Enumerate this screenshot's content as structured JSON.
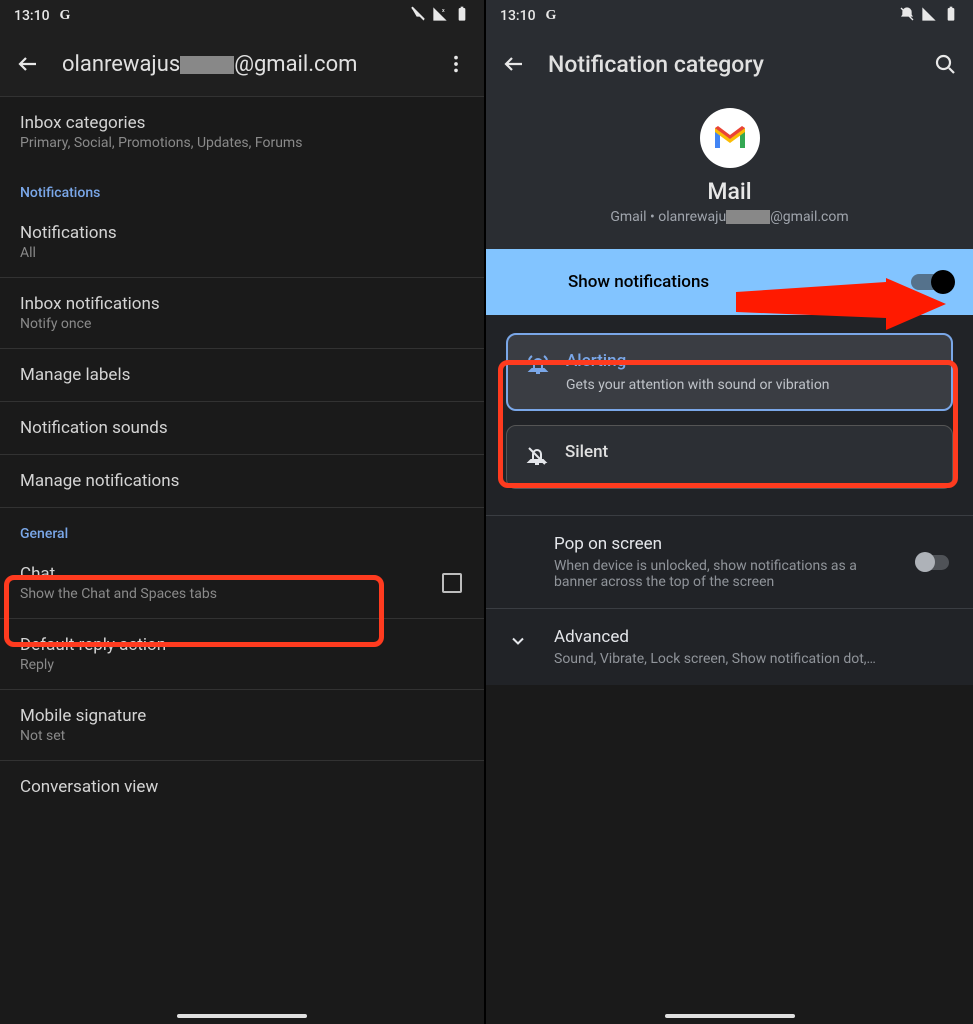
{
  "status": {
    "time": "13:10",
    "g": "G"
  },
  "left": {
    "title_prefix": "olanrewajus",
    "title_suffix": "@gmail.com",
    "rows": {
      "inbox_cat": {
        "title": "Inbox categories",
        "sub": "Primary, Social, Promotions, Updates, Forums"
      },
      "notif_header": "Notifications",
      "notifications": {
        "title": "Notifications",
        "sub": "All"
      },
      "inbox_notif": {
        "title": "Inbox notifications",
        "sub": "Notify once"
      },
      "manage_labels": {
        "title": "Manage labels"
      },
      "notif_sounds": {
        "title": "Notification sounds"
      },
      "manage_notif": {
        "title": "Manage notifications"
      },
      "general_header": "General",
      "chat": {
        "title": "Chat",
        "sub": "Show the Chat and Spaces tabs"
      },
      "reply": {
        "title": "Default reply action",
        "sub": "Reply"
      },
      "signature": {
        "title": "Mobile signature",
        "sub": "Not set"
      },
      "conv": {
        "title": "Conversation view"
      }
    }
  },
  "right": {
    "title": "Notification category",
    "app_name": "Mail",
    "app_sub_prefix": "Gmail • olanrewaju",
    "app_sub_suffix": "@gmail.com",
    "show_notif": "Show notifications",
    "alerting": {
      "title": "Alerting",
      "desc": "Gets your attention with sound or vibration"
    },
    "silent": {
      "title": "Silent"
    },
    "pop": {
      "title": "Pop on screen",
      "sub": "When device is unlocked, show notifications as a banner across the top of the screen"
    },
    "advanced": {
      "title": "Advanced",
      "sub": "Sound, Vibrate, Lock screen, Show notification dot,…"
    }
  }
}
